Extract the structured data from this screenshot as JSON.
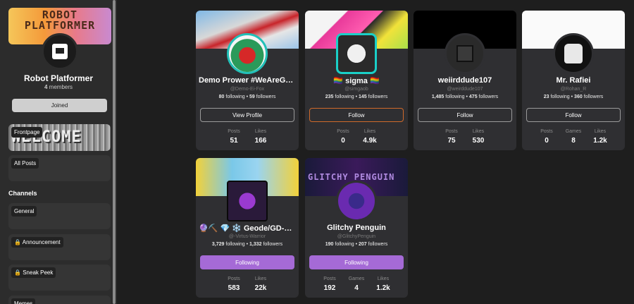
{
  "group": {
    "banner_text": "ROBOT PLATFORMER",
    "name": "Robot Platformer",
    "members_count": "4",
    "members_label": "members",
    "joined_label": "Joined"
  },
  "sidebar": {
    "frontpage_label": "Frontpage",
    "welcome_text": "WELCOME",
    "all_posts_label": "All Posts",
    "channels_heading": "Channels",
    "channels": [
      "General",
      "Announcement",
      "Sneak Peek",
      "Memes"
    ]
  },
  "profiles": [
    {
      "name": "Demo Prower #WeAreGa...",
      "handle": "@Demo-Ei-Fox",
      "following": "80",
      "followers": "59",
      "button": "View Profile",
      "stat1_label": "Posts",
      "stat1_value": "51",
      "stat2_label": "Likes",
      "stat2_value": "166"
    },
    {
      "name": "🏳️‍🌈 sigma 🏳️‍🌈",
      "handle": "@simgaob",
      "following": "235",
      "followers": "145",
      "button": "Follow",
      "stat1_label": "Posts",
      "stat1_value": "0",
      "stat2_label": "Likes",
      "stat2_value": "4.9k"
    },
    {
      "name": "weiirddude107",
      "handle": "@weirddude107",
      "following": "1,485",
      "followers": "475",
      "button": "Follow",
      "stat1_label": "Posts",
      "stat1_value": "75",
      "stat2_label": "Likes",
      "stat2_value": "530"
    },
    {
      "name": "Mr. Rafiei",
      "handle": "@Rohan_R",
      "following": "23",
      "followers": "360",
      "button": "Follow",
      "stat1_label": "Posts",
      "stat1_value": "0",
      "stat2_label": "Games",
      "stat2_value": "8",
      "stat3_label": "Likes",
      "stat3_value": "1.2k"
    },
    {
      "name": "🔮⛏️ 💎 ❄️ Geode/GD-Fro...",
      "handle": "@-Virtus-Warrior",
      "following": "3,729",
      "followers": "1,332",
      "button": "Following",
      "stat1_label": "Posts",
      "stat1_value": "583",
      "stat2_label": "Likes",
      "stat2_value": "22k"
    },
    {
      "name": "Glitchy Penguin",
      "handle": "@GlitchyPenguin",
      "following": "190",
      "followers": "207",
      "button": "Following",
      "stat1_label": "Posts",
      "stat1_value": "192",
      "stat2_label": "Games",
      "stat2_value": "4",
      "stat3_label": "Likes",
      "stat3_value": "1.2k"
    }
  ],
  "labels": {
    "following": "following",
    "followers": "followers",
    "dot": "•"
  },
  "banner_texts": {
    "glitchy": "GLITCHY PENGUIN"
  },
  "colors": {
    "accent_purple": "#a56ad6",
    "follow_orange": "#d06a2a",
    "card_bg": "#2f2f32"
  }
}
